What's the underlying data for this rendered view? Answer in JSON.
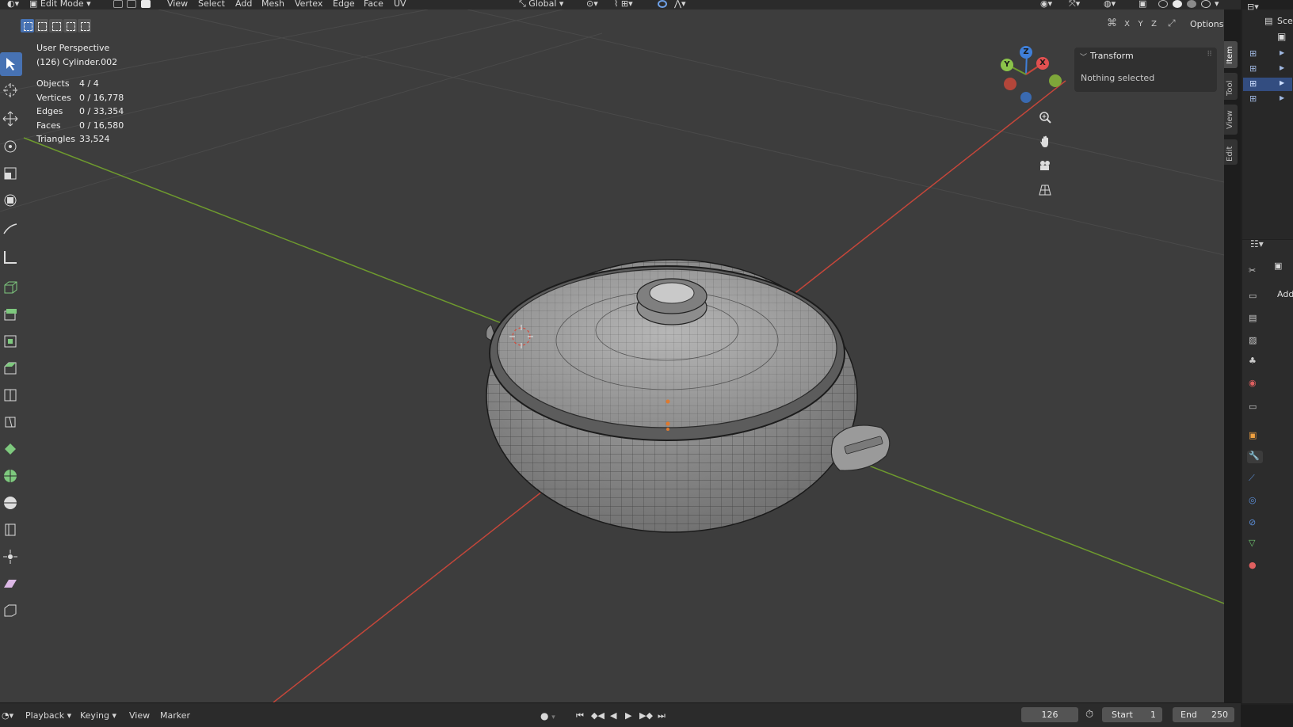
{
  "header": {
    "mode": "Edit Mode",
    "menus": [
      "View",
      "Select",
      "Add",
      "Mesh",
      "Vertex",
      "Edge",
      "Face",
      "UV"
    ],
    "orientation": "Global"
  },
  "viewport": {
    "view_name": "User Perspective",
    "object_name": "(126) Cylinder.002",
    "stats": [
      {
        "label": "Objects",
        "value": "4 / 4"
      },
      {
        "label": "Vertices",
        "value": "0 / 16,778"
      },
      {
        "label": "Edges",
        "value": "0 / 33,354"
      },
      {
        "label": "Faces",
        "value": "0 / 16,580"
      },
      {
        "label": "Triangles",
        "value": "33,524"
      }
    ],
    "axis_lock": [
      "X",
      "Y",
      "Z"
    ],
    "options_label": "Options",
    "gizmo_labels": {
      "x": "X",
      "y": "Y",
      "z": "Z"
    }
  },
  "npanel": {
    "section_title": "Transform",
    "message": "Nothing selected",
    "tabs": [
      "Item",
      "Tool",
      "View",
      "Edit"
    ]
  },
  "outliner": {
    "header_text": "Sce"
  },
  "properties": {
    "add_label": "Add"
  },
  "timeline": {
    "menus": [
      "Playback",
      "Keying",
      "View",
      "Marker"
    ],
    "current_frame": "126",
    "start_label": "Start",
    "start_value": "1",
    "end_label": "End",
    "end_value": "250"
  },
  "colors": {
    "accent": "#4772b3",
    "viewport_bg": "#3d3d3d",
    "axis_x": "#c4463a",
    "axis_y": "#6e9a2e",
    "gizmo_z": "#3f7fd9"
  }
}
